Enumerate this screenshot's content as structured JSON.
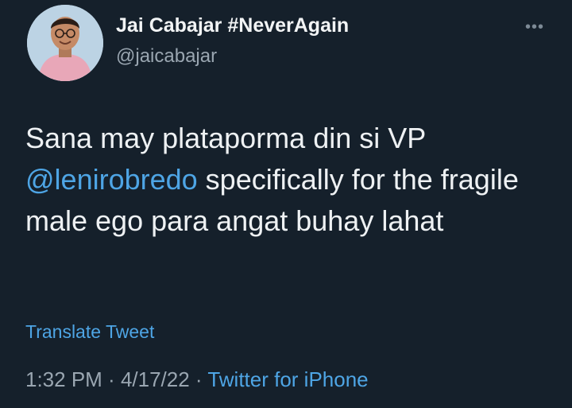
{
  "author": {
    "display_name": "Jai Cabajar #NeverAgain",
    "handle": "@jaicabajar"
  },
  "menu": {
    "more_icon": "•••"
  },
  "tweet": {
    "text_line1": "Sana may plataporma din si VP",
    "mention": "@lenirobredo",
    "text_after_mention": " specifically for the fragile male ego para angat buhay lahat"
  },
  "actions": {
    "translate_label": "Translate Tweet"
  },
  "meta": {
    "time": "1:32 PM",
    "separator": " · ",
    "date": "4/17/22",
    "source": "Twitter for iPhone"
  },
  "colors": {
    "background": "#15202b",
    "link": "#4ea5e5",
    "muted": "#9aa6b1"
  }
}
